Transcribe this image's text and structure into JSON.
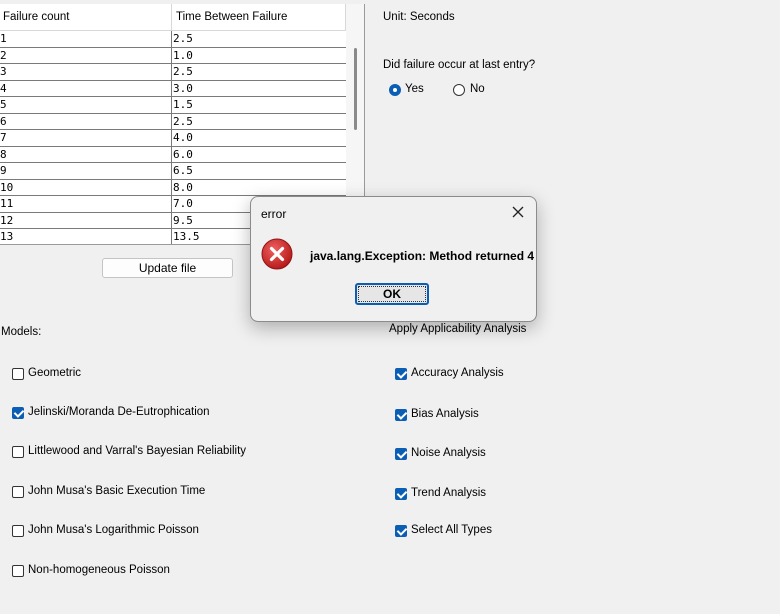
{
  "table": {
    "headers": [
      "Failure count",
      "Time Between Failure"
    ],
    "rows": [
      [
        "1",
        "2.5"
      ],
      [
        "2",
        "1.0"
      ],
      [
        "3",
        "2.5"
      ],
      [
        "4",
        "3.0"
      ],
      [
        "5",
        "1.5"
      ],
      [
        "6",
        "2.5"
      ],
      [
        "7",
        "4.0"
      ],
      [
        "8",
        "6.0"
      ],
      [
        "9",
        "6.5"
      ],
      [
        "10",
        "8.0"
      ],
      [
        "11",
        "7.0"
      ],
      [
        "12",
        "9.5"
      ],
      [
        "13",
        "13.5"
      ]
    ]
  },
  "update_button": "Update file",
  "unit_label": "Unit: Seconds",
  "failure_question": "Did failure occur at last entry?",
  "failure_options": [
    {
      "label": "Yes",
      "selected": true
    },
    {
      "label": "No",
      "selected": false
    }
  ],
  "models_label": "Models:",
  "models": [
    {
      "label": "Geometric",
      "checked": false
    },
    {
      "label": "Jelinski/Moranda De-Eutrophication",
      "checked": true
    },
    {
      "label": "Littlewood and Varral's Bayesian Reliability",
      "checked": false
    },
    {
      "label": "John Musa's Basic Execution Time",
      "checked": false
    },
    {
      "label": "John Musa's Logarithmic Poisson",
      "checked": false
    },
    {
      "label": "Non-homogeneous Poisson",
      "checked": false
    }
  ],
  "analysis_label": "Apply Applicability Analysis",
  "analyses": [
    {
      "label": "Accuracy Analysis",
      "checked": true
    },
    {
      "label": "Bias Analysis",
      "checked": true
    },
    {
      "label": "Noise Analysis",
      "checked": true
    },
    {
      "label": "Trend Analysis",
      "checked": true
    },
    {
      "label": "Select All Types",
      "checked": true
    }
  ],
  "dialog": {
    "title": "error",
    "message": "java.lang.Exception: Method returned 4",
    "ok_label": "OK",
    "icon": "error-icon"
  },
  "colors": {
    "accent": "#0a5fb4",
    "error_red": "#c62828"
  }
}
